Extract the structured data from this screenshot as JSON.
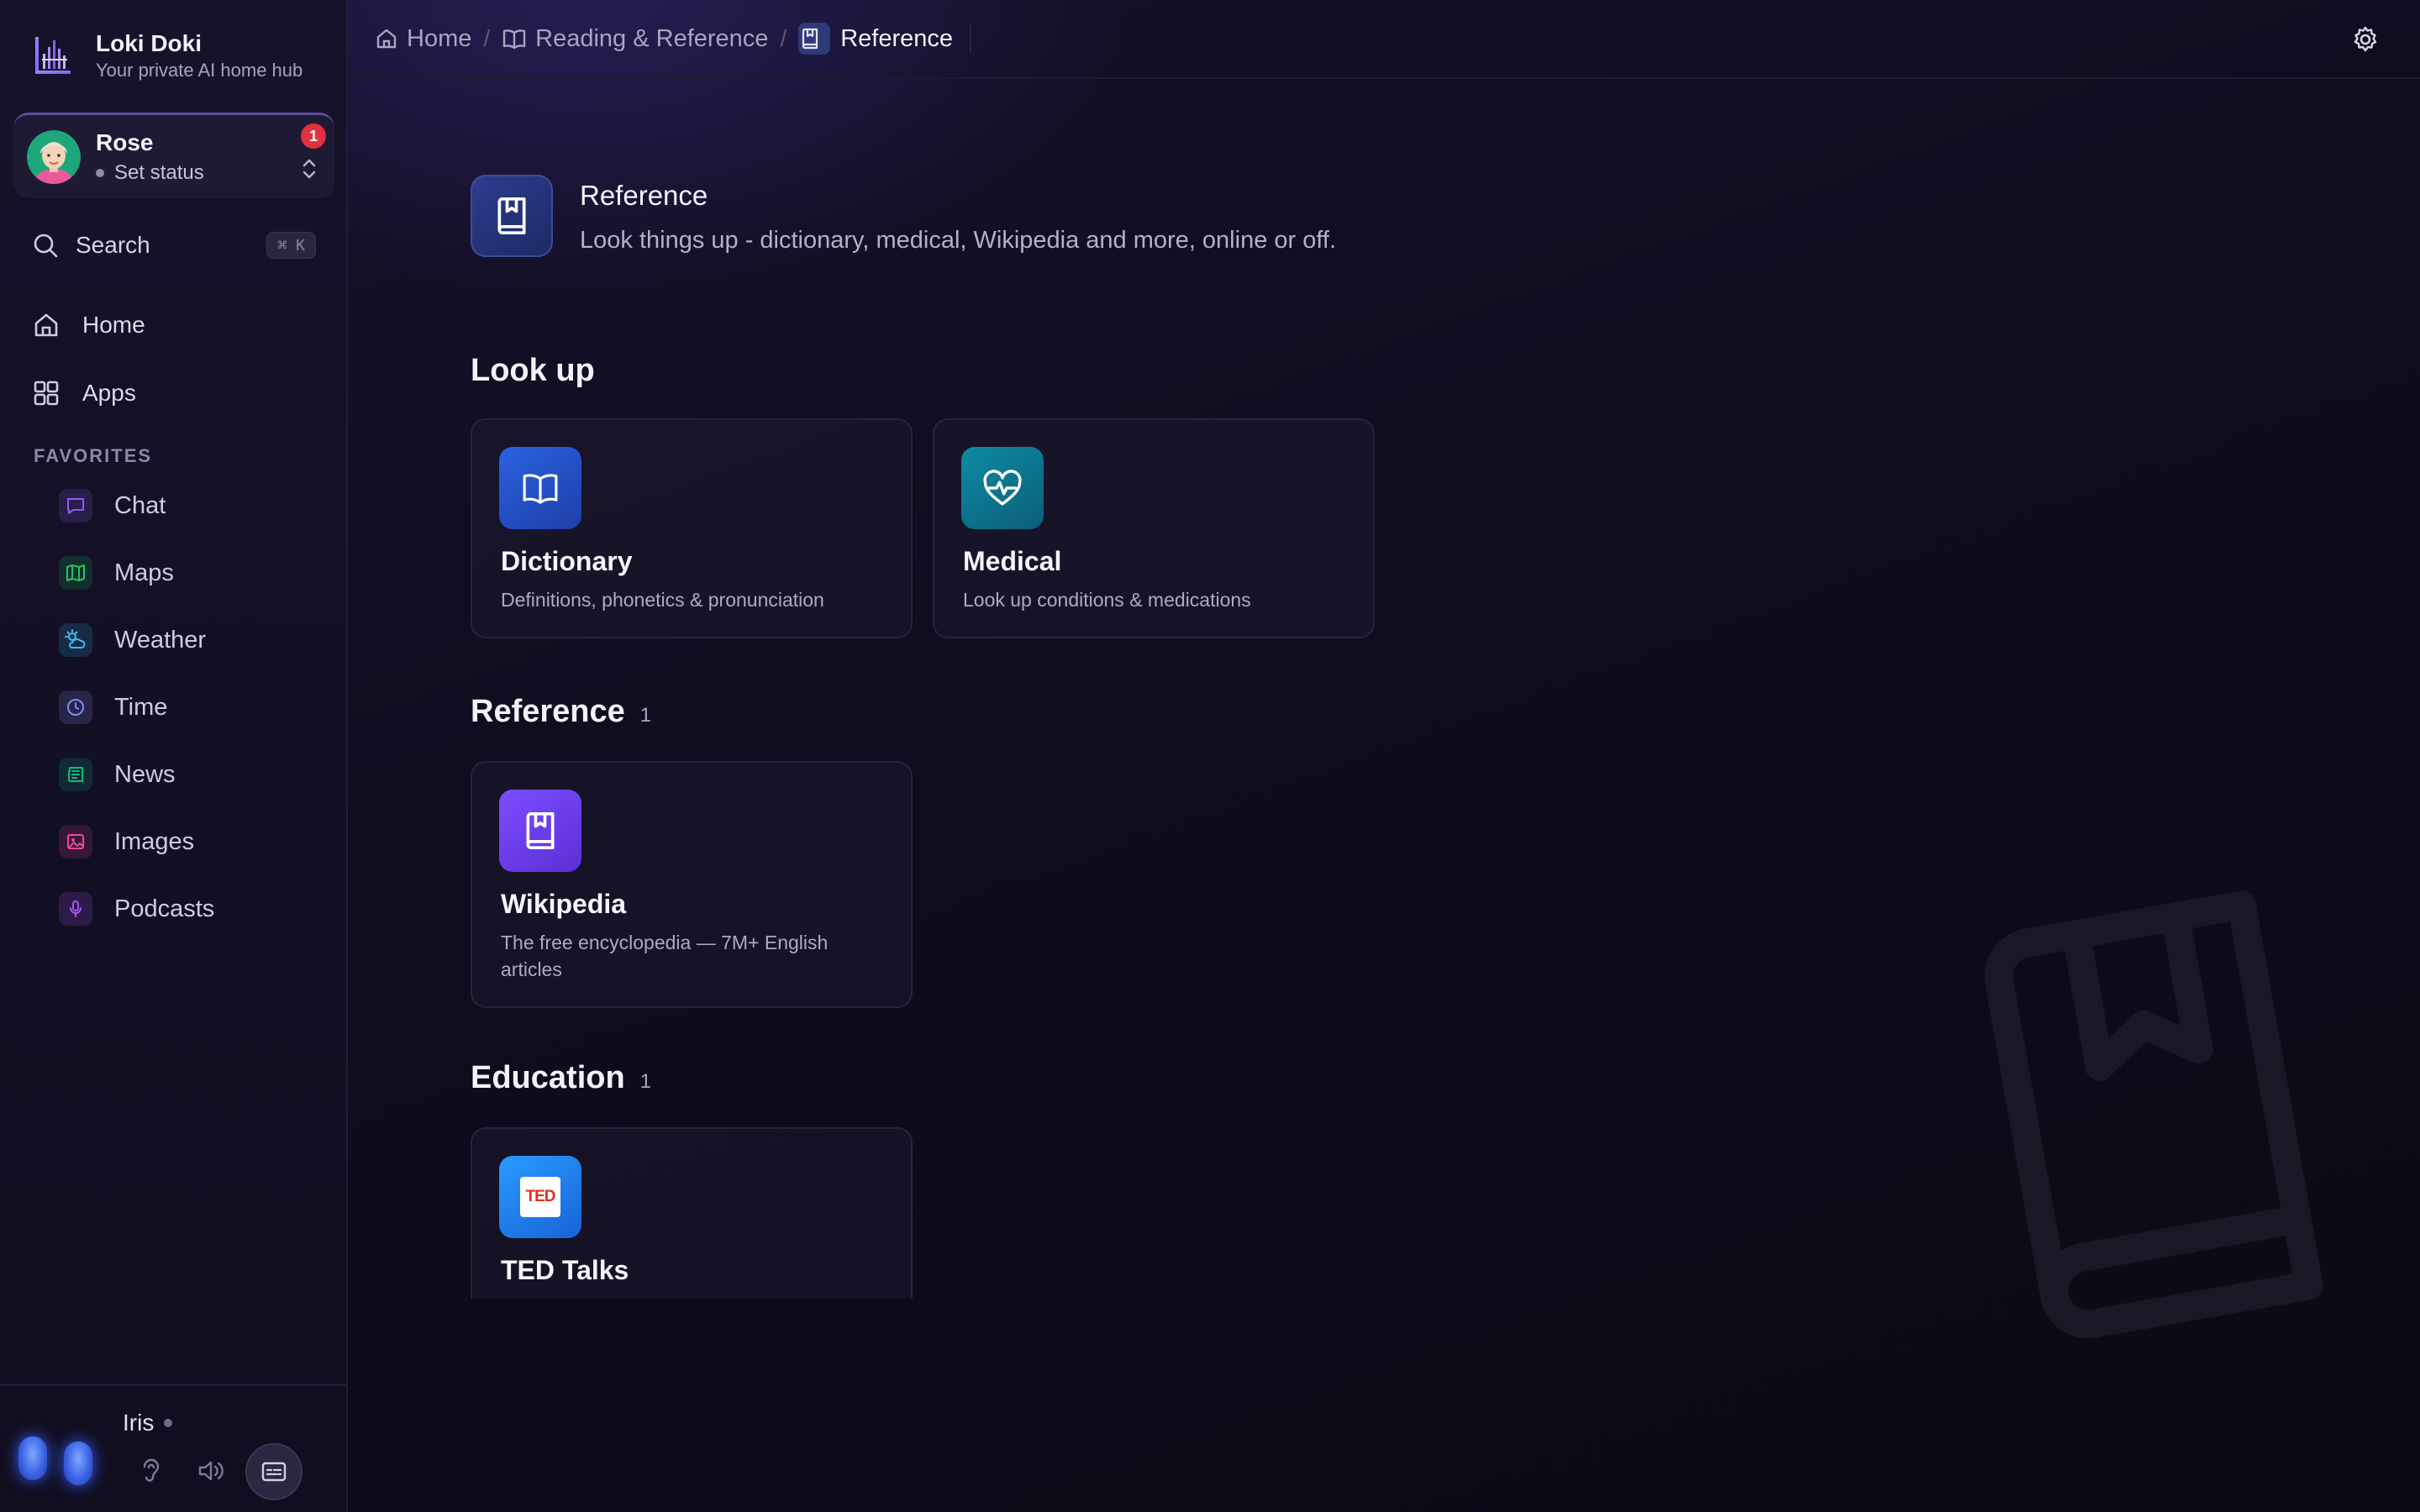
{
  "brand": {
    "title": "Loki Doki",
    "subtitle": "Your private AI home hub"
  },
  "user": {
    "name": "Rose",
    "status": "Set status",
    "notifications": "1"
  },
  "search": {
    "label": "Search",
    "shortcut": "⌘ K"
  },
  "nav": [
    {
      "label": "Home",
      "icon": "home-icon"
    },
    {
      "label": "Apps",
      "icon": "grid-icon"
    }
  ],
  "favorites": {
    "header": "FAVORITES",
    "items": [
      {
        "label": "Chat",
        "icon": "chat-icon",
        "color": "#8b5cf6"
      },
      {
        "label": "Maps",
        "icon": "map-icon",
        "color": "#22c55e"
      },
      {
        "label": "Weather",
        "icon": "weather-icon",
        "color": "#38bdf8"
      },
      {
        "label": "Time",
        "icon": "clock-icon",
        "color": "#818cf8"
      },
      {
        "label": "News",
        "icon": "newspaper-icon",
        "color": "#10b981"
      },
      {
        "label": "Images",
        "icon": "image-icon",
        "color": "#ec4899"
      },
      {
        "label": "Podcasts",
        "icon": "mic-icon",
        "color": "#a855f7"
      }
    ]
  },
  "assistant": {
    "name": "Iris"
  },
  "breadcrumb": [
    {
      "label": "Home",
      "icon": "home-icon"
    },
    {
      "label": "Reading & Reference",
      "icon": "book-open-icon"
    },
    {
      "label": "Reference",
      "icon": "bookmark-book-icon"
    }
  ],
  "hero": {
    "title": "Reference",
    "subtitle": "Look things up - dictionary, medical, Wikipedia and more, online or off."
  },
  "sections": [
    {
      "title": "Look up",
      "count": "",
      "cards": [
        {
          "title": "Dictionary",
          "desc": "Definitions, phonetics & pronunciation",
          "icon": "book-open-icon",
          "color": "#2563eb"
        },
        {
          "title": "Medical",
          "desc": "Look up conditions & medications",
          "icon": "heart-pulse-icon",
          "color": "#0e7490"
        }
      ]
    },
    {
      "title": "Reference",
      "count": "1",
      "cards": [
        {
          "title": "Wikipedia",
          "desc": "The free encyclopedia — 7M+ English articles",
          "icon": "bookmark-book-icon",
          "color": "#7c3aed"
        }
      ]
    },
    {
      "title": "Education",
      "count": "1",
      "cards": [
        {
          "title": "TED Talks",
          "desc": "",
          "icon": "ted-logo",
          "logo_text": "TED",
          "color": "#1d8bf1"
        }
      ]
    }
  ],
  "colors": {
    "accent": "#7c3aed",
    "badge": "#e0313f",
    "background": "#0d0b16"
  }
}
